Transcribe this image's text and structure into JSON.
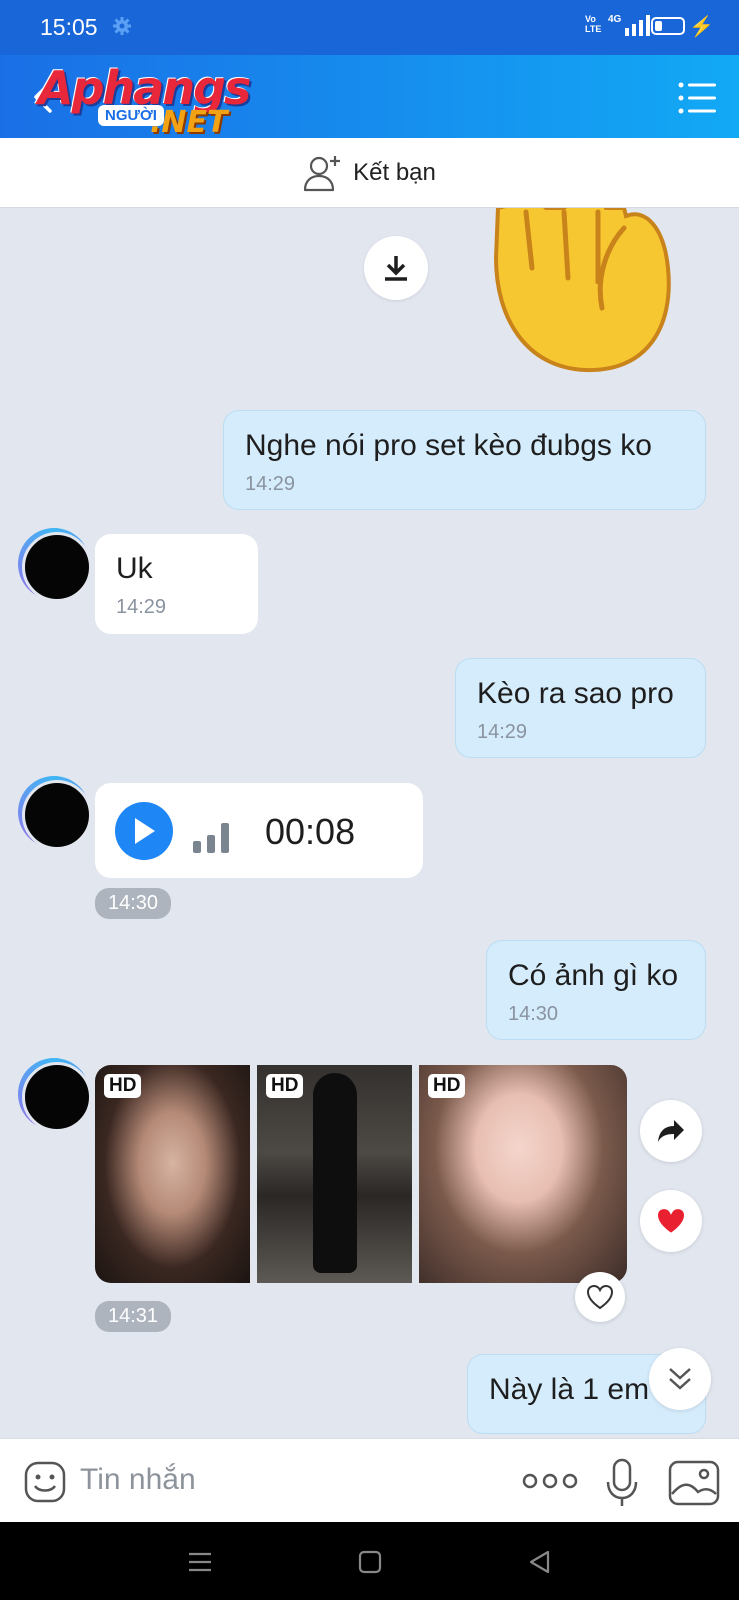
{
  "status_bar": {
    "time": "15:05",
    "network_text": "Vo LTE",
    "network_type": "4G",
    "icons": [
      "settings-gear-icon",
      "signal-icon",
      "battery-icon",
      "charging-bolt-icon"
    ]
  },
  "header": {
    "logo": {
      "brand": "Aphangs",
      "badge": "NGƯỜI",
      "suffix": ".NET"
    },
    "icons": [
      "back-arrow-icon",
      "menu-list-icon"
    ]
  },
  "friend_bar": {
    "label": "Kết bạn",
    "icon": "add-friend-icon"
  },
  "chat": {
    "messages": [
      {
        "direction": "out",
        "type": "text",
        "text": "Nghe nói pro set kèo đubgs ko",
        "time": "14:29"
      },
      {
        "direction": "in",
        "type": "text",
        "text": "Uk",
        "time": "14:29"
      },
      {
        "direction": "out",
        "type": "text",
        "text": "Kèo ra sao pro",
        "time": "14:29"
      },
      {
        "direction": "in",
        "type": "voice",
        "duration": "00:08",
        "time": "14:30"
      },
      {
        "direction": "out",
        "type": "text",
        "text": "Có ảnh gì ko",
        "time": "14:30"
      },
      {
        "direction": "in",
        "type": "photos",
        "badges": [
          "HD",
          "HD",
          "HD"
        ],
        "time": "14:31"
      },
      {
        "direction": "out",
        "type": "text",
        "text": "Này là 1 em"
      }
    ]
  },
  "input_bar": {
    "placeholder": "Tin nhắn"
  },
  "colors": {
    "header_start": "#1a6fe6",
    "header_end": "#12a9f5",
    "outgoing_bubble": "#d5ecfc",
    "chat_background": "#e2e7ef",
    "play_button": "#1e86f5",
    "heart": "#e8202f"
  }
}
